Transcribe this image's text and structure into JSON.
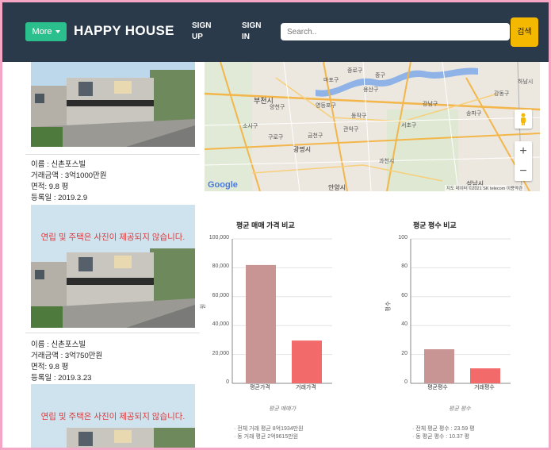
{
  "header": {
    "more_label": "More",
    "brand": "HAPPY HOUSE",
    "sign_up": "SIGN UP",
    "sign_in": "SIGN IN",
    "search_placeholder": "Search..",
    "search_button": "검색"
  },
  "listings": [
    {
      "image_text": "",
      "name": "이름 : 신촌포스빌",
      "price": "거래금액 : 3억1000만원",
      "area": "면적: 9.8 평",
      "date": "등록일 : 2019.2.9"
    },
    {
      "image_text": "연립 및 주택은 사진이 제공되지 않습니다.",
      "name": "이름 : 신촌포스빌",
      "price": "거래금액 : 3억750만원",
      "area": "면적: 9.8 평",
      "date": "등록일 : 2019.3.23"
    },
    {
      "image_text": "연립 및 주택은 사진이 제공되지 않습니다."
    }
  ],
  "map": {
    "copyright": "지도 데이터 ©2021 SK telecom    이용약관",
    "google": "Google",
    "labels": [
      "부천시",
      "소사구",
      "광명시",
      "안양시",
      "영등포구",
      "마포구",
      "용산구",
      "서초구",
      "강남구",
      "관악구",
      "금천구",
      "송파구",
      "하남시",
      "성남시",
      "종로구",
      "동작구",
      "양천구",
      "구로구",
      "중구",
      "강동구",
      "과천시"
    ]
  },
  "chart_data": [
    {
      "type": "bar",
      "title": "평균 매매 가격 비교",
      "categories": [
        "평균가격",
        "거래가격"
      ],
      "values": [
        81934,
        29615
      ],
      "colors": [
        "#c99494",
        "#f26a6a"
      ],
      "ylabel": "원",
      "ylim": [
        0,
        100000
      ],
      "yticks": [
        "0",
        "20,000",
        "40,000",
        "60,000",
        "80,000",
        "100,000"
      ],
      "caption": "평균 매매가",
      "stats": [
        "· 전체 거래 평균 8억1934만원",
        "· 동 거래 평균 2억9615만원"
      ]
    },
    {
      "type": "bar",
      "title": "평균 평수 비교",
      "categories": [
        "평균평수",
        "거래평수"
      ],
      "values": [
        23.59,
        10.37
      ],
      "colors": [
        "#c99494",
        "#f26a6a"
      ],
      "ylabel": "평수",
      "ylim": [
        0,
        100
      ],
      "yticks": [
        "0",
        "20",
        "40",
        "60",
        "80",
        "100"
      ],
      "caption": "평균 평수",
      "stats": [
        "· 전체 평균 평수 : 23.59 평",
        "· 동 평균 평수 : 10.37 평"
      ]
    }
  ]
}
